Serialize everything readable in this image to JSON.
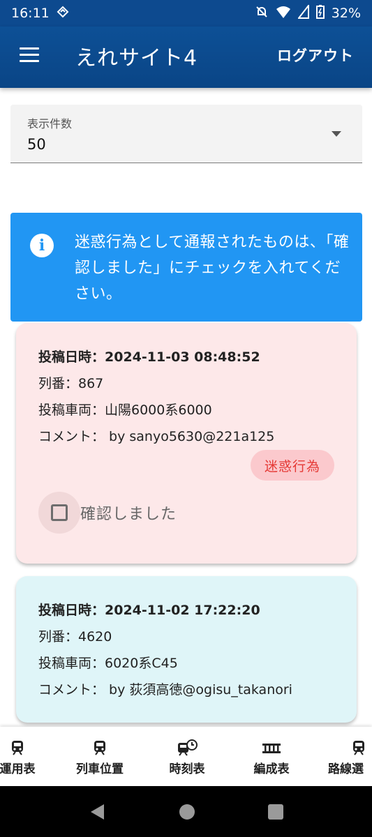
{
  "status_bar": {
    "time": "16:11",
    "battery": "32%"
  },
  "app_bar": {
    "title": "えれサイト4",
    "logout": "ログアウト"
  },
  "display_count": {
    "label": "表示件数",
    "value": "50"
  },
  "alert": {
    "text": "迷惑行為として通報されたものは、「確認しました」にチェックを入れてください。"
  },
  "posts": [
    {
      "datetime_line": "投稿日時：2024-11-03 08:48:52",
      "train_no": "列番：867",
      "vehicle": "投稿車両：山陽6000系6000",
      "comment": "コメント： by sanyo5630@221a125",
      "badge": "迷惑行為",
      "confirm_label": "確認しました"
    },
    {
      "datetime_line": "投稿日時：2024-11-02 17:22:20",
      "train_no": "列番：4620",
      "vehicle": "投稿車両：6020系C45",
      "comment": "コメント： by 荻須高徳@ogisu_takanori"
    }
  ],
  "bottom_nav": [
    {
      "label": "運用表",
      "icon": "train-icon"
    },
    {
      "label": "列車位置",
      "icon": "train-icon"
    },
    {
      "label": "時刻表",
      "icon": "train-clock-icon"
    },
    {
      "label": "編成表",
      "icon": "railway-icon"
    },
    {
      "label": "路線選",
      "icon": "train-icon"
    }
  ],
  "colors": {
    "appbar": "#0d4a8f",
    "alert": "#2196f3",
    "card_report": "#fde8e9",
    "card_normal": "#dff5f8",
    "badge_text": "#e53935"
  }
}
